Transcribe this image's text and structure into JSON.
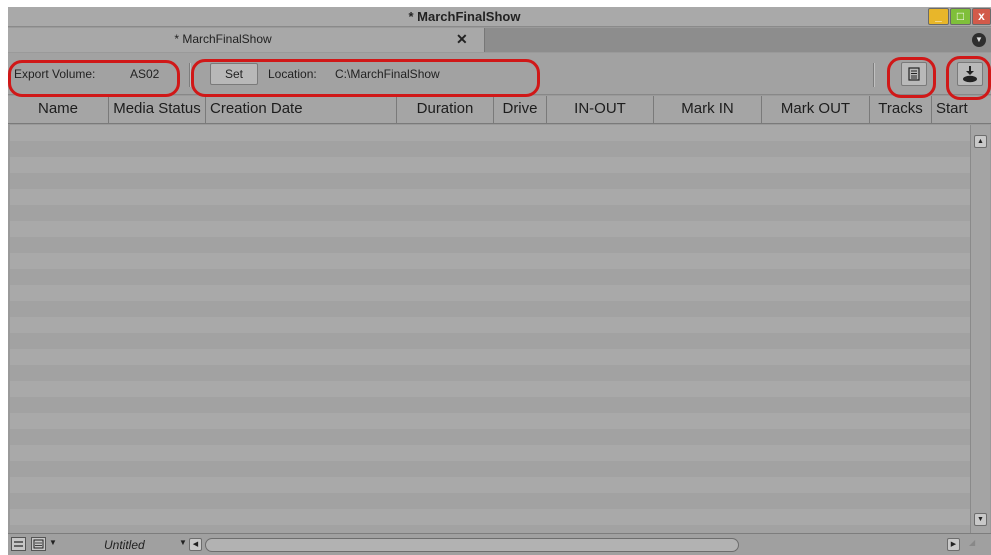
{
  "window": {
    "title": "* MarchFinalShow",
    "minimize_label": "_",
    "maximize_label": "□",
    "close_label": "x"
  },
  "tab": {
    "label": "* MarchFinalShow",
    "close_label": "✕",
    "menu_icon": "chevron-down-circle-icon"
  },
  "toolbar": {
    "export_label": "Export Volume:",
    "export_value": "AS02",
    "set_label": "Set",
    "location_label": "Location:",
    "location_value": "C:\\MarchFinalShow",
    "list_view_icon": "list-view-icon",
    "export_icon": "download-icon"
  },
  "columns": [
    "Name",
    "Media Status",
    "Creation Date",
    "Duration",
    "Drive",
    "IN-OUT",
    "Mark IN",
    "Mark OUT",
    "Tracks",
    "Start"
  ],
  "rows": [],
  "bottom": {
    "view_name": "Untitled"
  },
  "colors": {
    "highlight": "#d01818"
  }
}
